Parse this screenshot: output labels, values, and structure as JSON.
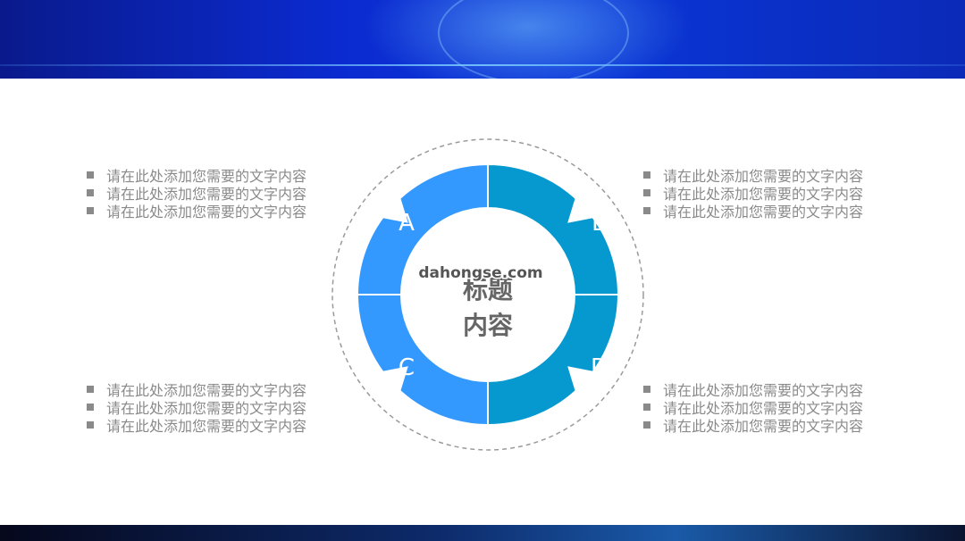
{
  "diagram": {
    "center_title_line1": "标题",
    "center_title_line2": "内容",
    "watermark": "dahongse.com",
    "segments": [
      {
        "label": "A",
        "color": "#3399ff"
      },
      {
        "label": "B",
        "color": "#0599cf"
      },
      {
        "label": "C",
        "color": "#3399ff"
      },
      {
        "label": "D",
        "color": "#0599cf"
      }
    ]
  },
  "text_blocks": {
    "top_left": [
      "请在此处添加您需要的文字内容",
      "请在此处添加您需要的文字内容",
      "请在此处添加您需要的文字内容"
    ],
    "top_right": [
      "请在此处添加您需要的文字内容",
      "请在此处添加您需要的文字内容",
      "请在此处添加您需要的文字内容"
    ],
    "bottom_left": [
      "请在此处添加您需要的文字内容",
      "请在此处添加您需要的文字内容",
      "请在此处添加您需要的文字内容"
    ],
    "bottom_right": [
      "请在此处添加您需要的文字内容",
      "请在此处添加您需要的文字内容",
      "请在此处添加您需要的文字内容"
    ]
  },
  "colors": {
    "text_gray": "#8a8a8a",
    "header_blue": "#0b2bd0"
  }
}
